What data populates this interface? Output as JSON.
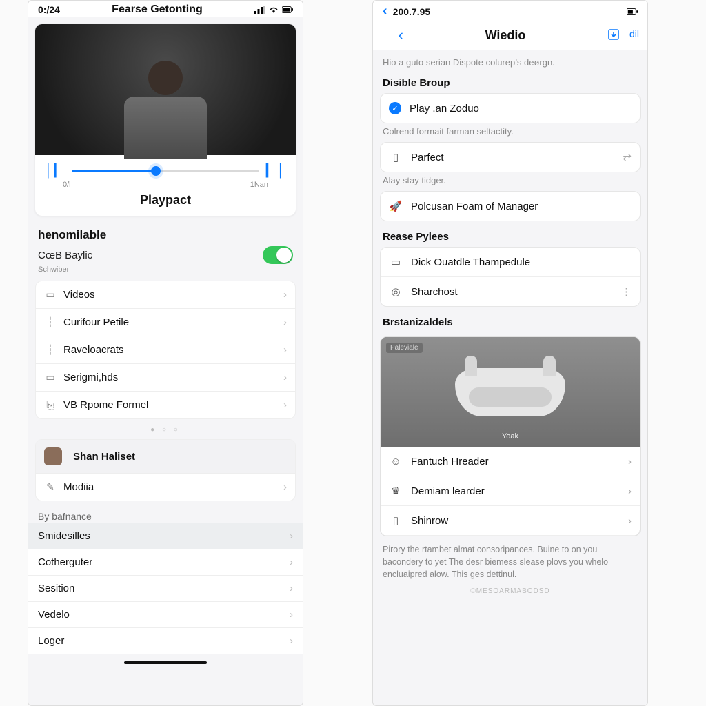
{
  "left": {
    "status": {
      "time": "0:/24",
      "title": "Fearse Getonting"
    },
    "media": {
      "start": "0/l",
      "end": "1Nan",
      "title": "Playpact"
    },
    "section_header": "henomilable",
    "toggle_label": "CœB Baylic",
    "sub_label": "Schwiber",
    "list": [
      {
        "icon": "video-icon",
        "label": "Videos"
      },
      {
        "icon": "bar-icon",
        "label": "Curifour Petile"
      },
      {
        "icon": "bar-icon",
        "label": "Raveloacrats"
      },
      {
        "icon": "doc-icon",
        "label": "Serigmi,hds"
      },
      {
        "icon": "clip-icon",
        "label": "VB Rpome Formel"
      }
    ],
    "profile": {
      "name": "Shan Haliset"
    },
    "profile_rows": [
      {
        "icon": "pen-icon",
        "label": "Modiia"
      }
    ],
    "flat_header": "By bafnance",
    "flat": [
      {
        "label": "Smidesilles",
        "active": true
      },
      {
        "label": "Cotherguter"
      },
      {
        "label": "Sesition"
      },
      {
        "label": "Vedelo"
      },
      {
        "label": "Loger"
      }
    ]
  },
  "right": {
    "status": {
      "time": "200.7.95"
    },
    "nav": {
      "title": "Wiedio",
      "action": "dil"
    },
    "intro": "Hio a guto serian Dispote colurep’s deørgn.",
    "g1": {
      "title": "Disible Broup",
      "item": "Play .an Zoduo",
      "desc": "Colrend formait farman seltactity.",
      "item2": "Parfect",
      "desc2": "Alay stay tidger.",
      "item3": "Polcusan Foam of Manager"
    },
    "g2": {
      "title": "Rease Pylees",
      "items": [
        {
          "icon": "cal-icon",
          "label": "Dick Ouatdle Thampedule"
        },
        {
          "icon": "pin-icon",
          "label": "Sharchost",
          "more": true
        }
      ]
    },
    "g3": {
      "title": "Brstanizaldels",
      "badge": "Paleviale",
      "hero_label": "Yoak"
    },
    "prod_rows": [
      {
        "icon": "person-icon",
        "label": "Fantuch Hreader"
      },
      {
        "icon": "crown-icon",
        "label": "Demiam learder"
      },
      {
        "icon": "phone-icon",
        "label": "Shinrow"
      }
    ],
    "footer": "Pirory the rtambet almat consoripances. Buine to on you bacondery to yet The desr biemess slease plovs you whelo encluaipred alow. This ges dettinul.",
    "watermark": "©MESOARMABODSD"
  }
}
